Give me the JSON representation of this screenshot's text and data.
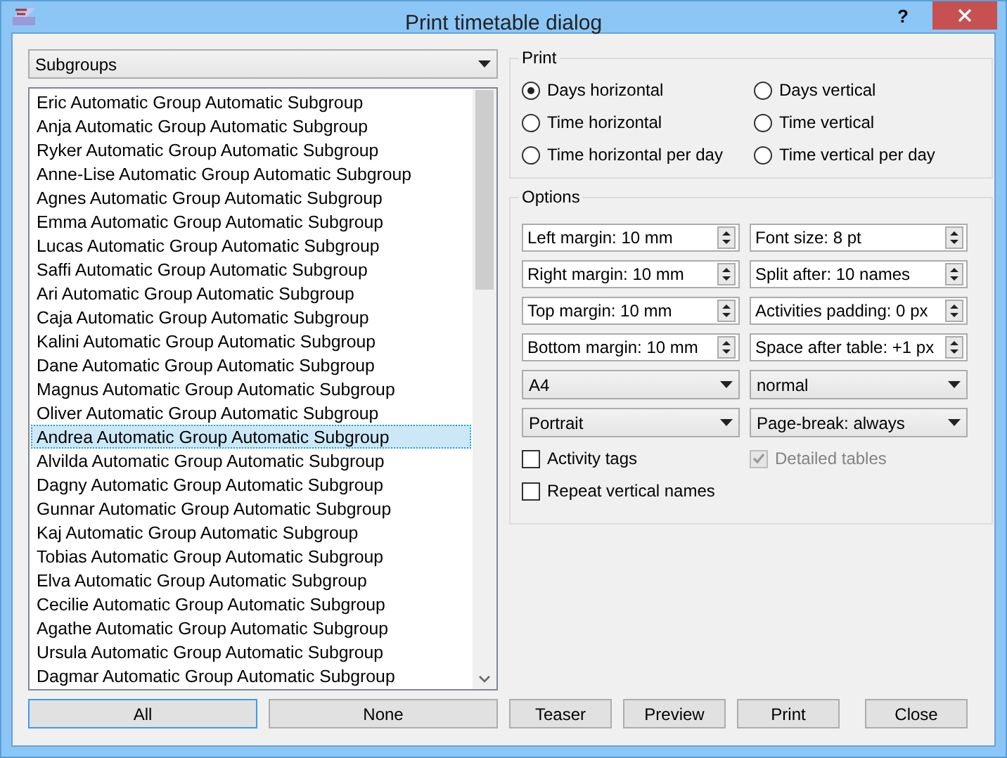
{
  "window": {
    "title": "Print timetable dialog",
    "help": "?"
  },
  "group_selector": {
    "value": "Subgroups"
  },
  "list": {
    "items": [
      {
        "label": "Eric Automatic Group Automatic Subgroup",
        "selected": false
      },
      {
        "label": "Anja Automatic Group Automatic Subgroup",
        "selected": false
      },
      {
        "label": "Ryker Automatic Group Automatic Subgroup",
        "selected": false
      },
      {
        "label": "Anne-Lise Automatic Group Automatic Subgroup",
        "selected": false
      },
      {
        "label": "Agnes Automatic Group Automatic Subgroup",
        "selected": false
      },
      {
        "label": "Emma Automatic Group Automatic Subgroup",
        "selected": false
      },
      {
        "label": "Lucas Automatic Group Automatic Subgroup",
        "selected": false
      },
      {
        "label": "Saffi Automatic Group Automatic Subgroup",
        "selected": false
      },
      {
        "label": "Ari Automatic Group Automatic Subgroup",
        "selected": false
      },
      {
        "label": "Caja Automatic Group Automatic Subgroup",
        "selected": false
      },
      {
        "label": "Kalini Automatic Group Automatic Subgroup",
        "selected": false
      },
      {
        "label": "Dane Automatic Group Automatic Subgroup",
        "selected": false
      },
      {
        "label": "Magnus Automatic Group Automatic Subgroup",
        "selected": false
      },
      {
        "label": "Oliver Automatic Group Automatic Subgroup",
        "selected": false
      },
      {
        "label": "Andrea Automatic Group Automatic Subgroup",
        "selected": true
      },
      {
        "label": "Alvilda Automatic Group Automatic Subgroup",
        "selected": false
      },
      {
        "label": "Dagny Automatic Group Automatic Subgroup",
        "selected": false
      },
      {
        "label": "Gunnar Automatic Group Automatic Subgroup",
        "selected": false
      },
      {
        "label": "Kaj Automatic Group Automatic Subgroup",
        "selected": false
      },
      {
        "label": "Tobias Automatic Group Automatic Subgroup",
        "selected": false
      },
      {
        "label": "Elva Automatic Group Automatic Subgroup",
        "selected": false
      },
      {
        "label": "Cecilie Automatic Group Automatic Subgroup",
        "selected": false
      },
      {
        "label": "Agathe Automatic Group Automatic Subgroup",
        "selected": false
      },
      {
        "label": "Ursula Automatic Group Automatic Subgroup",
        "selected": false
      },
      {
        "label": "Dagmar Automatic Group Automatic Subgroup",
        "selected": false
      }
    ]
  },
  "list_buttons": [
    {
      "label": "All",
      "default": true
    },
    {
      "label": "None",
      "default": false
    }
  ],
  "print": {
    "title": "Print",
    "options": [
      {
        "label": "Days horizontal",
        "selected": true
      },
      {
        "label": "Days vertical",
        "selected": false
      },
      {
        "label": "Time horizontal",
        "selected": false
      },
      {
        "label": "Time vertical",
        "selected": false
      },
      {
        "label": "Time horizontal per day",
        "selected": false
      },
      {
        "label": "Time vertical per day",
        "selected": false
      }
    ]
  },
  "options": {
    "title": "Options",
    "fields": [
      {
        "kind": "spin",
        "value": "Left margin: 10 mm"
      },
      {
        "kind": "spin",
        "value": "Font size: 8 pt"
      },
      {
        "kind": "spin",
        "value": "Right margin: 10 mm"
      },
      {
        "kind": "spin",
        "value": "Split after: 10 names"
      },
      {
        "kind": "spin",
        "value": "Top margin: 10 mm"
      },
      {
        "kind": "spin",
        "value": "Activities padding: 0 px"
      },
      {
        "kind": "spin",
        "value": "Bottom margin: 10 mm"
      },
      {
        "kind": "spin",
        "value": "Space after table: +1 px"
      },
      {
        "kind": "combo",
        "value": "A4"
      },
      {
        "kind": "combo",
        "value": "normal"
      },
      {
        "kind": "combo",
        "value": "Portrait"
      },
      {
        "kind": "combo",
        "value": "Page-break: always"
      }
    ],
    "checkboxes": [
      {
        "label": "Activity tags",
        "checked": false,
        "disabled": false
      },
      {
        "label": "Detailed tables",
        "checked": true,
        "disabled": true
      },
      {
        "label": "Repeat vertical names",
        "checked": false,
        "disabled": false
      }
    ]
  },
  "footer_buttons": [
    {
      "label": "Teaser"
    },
    {
      "label": "Preview"
    },
    {
      "label": "Print"
    },
    {
      "label": "Close"
    }
  ]
}
